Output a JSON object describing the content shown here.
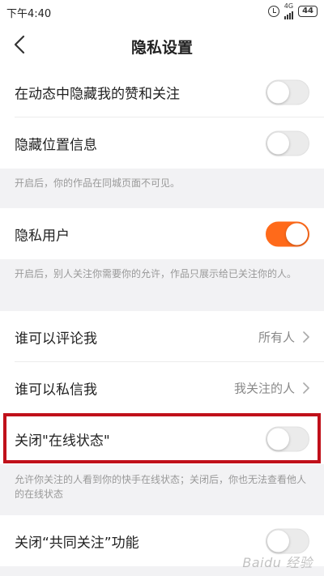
{
  "status_bar": {
    "time": "下午4:40",
    "network": "4G",
    "battery": "44",
    "icons": [
      "alarm-icon",
      "signal-icon",
      "battery-icon"
    ]
  },
  "nav": {
    "title": "隐私设置",
    "back_icon": "chevron-left-icon"
  },
  "settings": {
    "hide_likes": {
      "label": "在动态中隐藏我的赞和关注",
      "enabled": false
    },
    "hide_location": {
      "label": "隐藏位置信息",
      "enabled": false,
      "hint": "开启后，你的作品在同城页面不可见。"
    },
    "private_user": {
      "label": "隐私用户",
      "enabled": true,
      "hint": "开启后，别人关注你需要你的允许，作品只展示给已关注你的人。"
    },
    "who_can_comment": {
      "label": "谁可以评论我",
      "value": "所有人"
    },
    "who_can_message": {
      "label": "谁可以私信我",
      "value": "我关注的人"
    },
    "online_status": {
      "label": "关闭\"在线状态\"",
      "enabled": false,
      "hint": "允许你关注的人看到你的快手在线状态；关闭后，你也无法查看他人的在线状态"
    },
    "mutual_follow": {
      "label": "关闭“共同关注”功能",
      "enabled": false
    }
  },
  "colors": {
    "accent": "#ff6a1a",
    "highlight": "#c0101a",
    "background": "#f2f2f4"
  },
  "watermark": "Baidu 经验"
}
